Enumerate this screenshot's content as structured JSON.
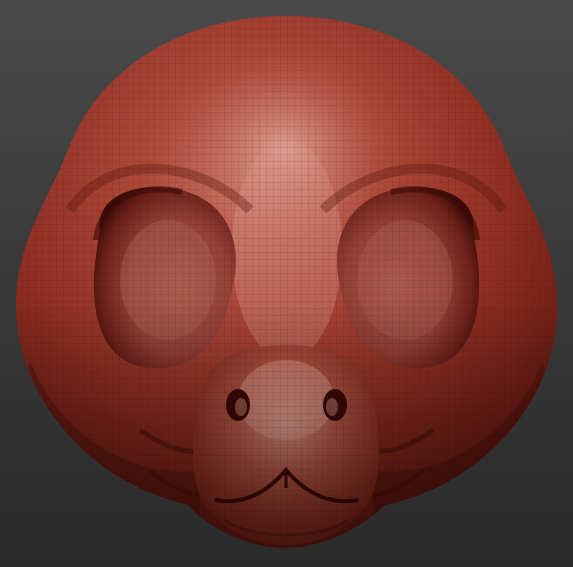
{
  "scene": {
    "subject": "sculpted-creature-head",
    "material_color": "#a0392c",
    "highlight_color": "#d8a79c",
    "shadow_color": "#4a0f0a",
    "background_top": "#4a4a4a",
    "background_bottom": "#2a2a2a",
    "wireframe_visible": true
  }
}
